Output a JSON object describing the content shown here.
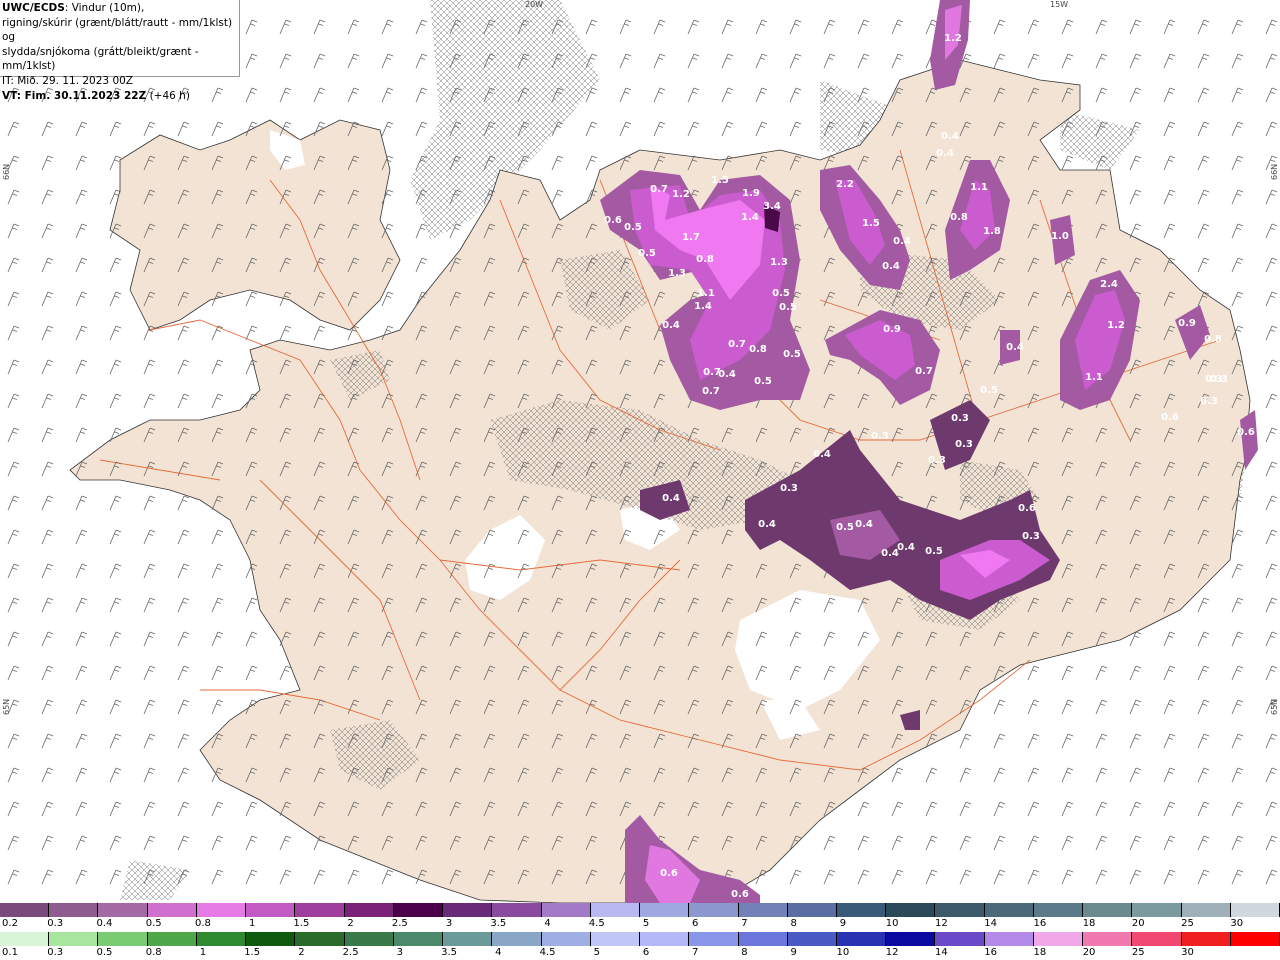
{
  "title": {
    "product": "UWC/ECDS",
    "line1_rest": ": Vindur (10m),",
    "line2": "rigning/skúrir (grænt/blátt/rautt - mm/1klst) og",
    "line3": "slydda/snjókoma (grátt/bleikt/grænt - mm/1klst)",
    "issue_time": "IT: Mið. 29. 11. 2023 00Z",
    "valid_label": "VT: Fim. 30.11.2023 22Z",
    "valid_offset": " (+46 h)"
  },
  "coords": {
    "top_20w": "20W",
    "top_15w": "15W",
    "left_66n": "66N",
    "right_66n": "66N",
    "left_65n": "65N",
    "right_65n": "65N"
  },
  "colors": {
    "sea": "#ffffff",
    "land": "#f2e3d5",
    "glacier": "#ffffff",
    "roads": "#e86a3a",
    "wind_barbs": "#555555",
    "snow_light": "#a35aa3",
    "snow_mid": "#ca5cd0",
    "snow_heavy": "#f078f0",
    "snow_extreme": "#4a0a4a"
  },
  "precip_labels": [
    "1.2",
    "0.4",
    "0.4",
    "0.7",
    "1.2",
    "1.5",
    "1.9",
    "3.4",
    "1.4",
    "2.2",
    "1.1",
    "0.6",
    "0.5",
    "1.7",
    "0.5",
    "1.3",
    "0.8",
    "1.3",
    "1.5",
    "0.4",
    "0.4",
    "0.8",
    "1.8",
    "1.0",
    "2.4",
    "1.2",
    "0.9",
    "1.1",
    "0.9",
    "0.8",
    "0.3",
    "0.3",
    "1.1",
    "1.4",
    "0.4",
    "0.5",
    "0.5",
    "0.7",
    "0.8",
    "0.5",
    "0.7",
    "0.4",
    "0.5",
    "0.7",
    "0.7",
    "0.4",
    "0.5",
    "0.3",
    "0.3",
    "0.3",
    "0.3",
    "0.6",
    "0.4",
    "0.3",
    "0.4",
    "0.4",
    "0.5",
    "0.4",
    "0.6",
    "0.5",
    "0.3",
    "0.4",
    "0.4",
    "0.6",
    "0.6",
    "0.6",
    "0.3"
  ],
  "legend_top": {
    "labels": [
      "0.2",
      "0.3",
      "0.4",
      "0.5",
      "0.8",
      "1",
      "1.5",
      "2",
      "2.5",
      "3",
      "3.5",
      "4",
      "4.5",
      "5",
      "6",
      "7",
      "8",
      "9",
      "10",
      "12",
      "14",
      "16",
      "18",
      "20",
      "25",
      "30"
    ],
    "colors": [
      "#7a4a7a",
      "#8e5c8e",
      "#a569a5",
      "#cf6fcf",
      "#e57ae5",
      "#c35ac3",
      "#9e3f9e",
      "#7a217a",
      "#4a004a",
      "#6a2a7a",
      "#8a4aa0",
      "#a27ac8",
      "#b8b8f2",
      "#a0a8e2",
      "#8c96cf",
      "#7282b8",
      "#5a6ea3",
      "#3a5a7a",
      "#2a4a5a",
      "#3a5a6a",
      "#4a6a7a",
      "#5a7a8a",
      "#6a8a90",
      "#7a9a9e",
      "#a0b0b8",
      "#cfd8dc"
    ]
  },
  "legend_bottom": {
    "labels": [
      "0.1",
      "0.3",
      "0.5",
      "0.8",
      "1",
      "1.5",
      "2",
      "2.5",
      "3",
      "3.5",
      "4",
      "4.5",
      "5",
      "6",
      "7",
      "8",
      "9",
      "10",
      "12",
      "14",
      "16",
      "18",
      "20",
      "25",
      "30"
    ],
    "colors": [
      "#d8f5d8",
      "#a8e6a0",
      "#7acc72",
      "#4ea84a",
      "#2e8a2e",
      "#0e5a0e",
      "#2a6a2a",
      "#3a7a4a",
      "#4a8a6a",
      "#6a9a9a",
      "#8aa6c6",
      "#a0aee6",
      "#c0c6f6",
      "#b4b8f8",
      "#8a96ea",
      "#6a76da",
      "#4a5ac4",
      "#2a32b4",
      "#0a0aa0",
      "#6a4ac8",
      "#b48ae8",
      "#f0a8e8",
      "#f07ab0",
      "#f04870",
      "#f02020",
      "#ff0000"
    ]
  }
}
